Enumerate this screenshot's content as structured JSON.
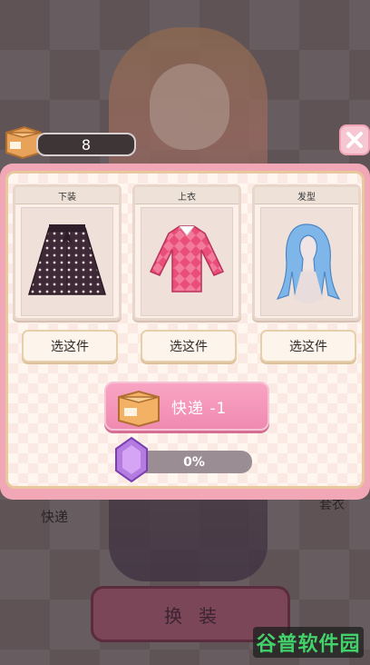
{
  "counter": {
    "value": "8"
  },
  "cards": [
    {
      "title": "下装",
      "button": "选这件",
      "icon": "polka-dot-skirt-icon"
    },
    {
      "title": "上衣",
      "button": "选这件",
      "icon": "argyle-sweater-icon"
    },
    {
      "title": "发型",
      "button": "选这件",
      "icon": "blue-hair-icon"
    }
  ],
  "express": {
    "label": "快递 -1",
    "icon": "crate-icon"
  },
  "progress": {
    "text": "0%",
    "fraction": 0
  },
  "background": {
    "left_label": "快递",
    "right_label": "套衣",
    "dress_button": "换装"
  },
  "watermark": {
    "text": "谷普软件园"
  },
  "colors": {
    "accent_pink": "#f08ab0",
    "panel_pink": "#f2a7b6",
    "gem_purple": "#b47be0"
  }
}
